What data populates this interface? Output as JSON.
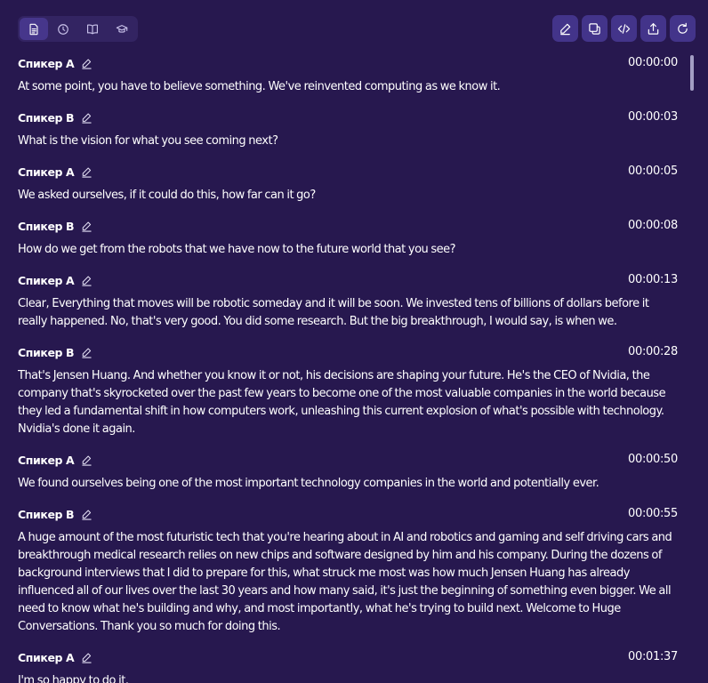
{
  "toolbar": {
    "tabs": [
      {
        "icon": "document-icon",
        "active": true
      },
      {
        "icon": "clock-icon",
        "active": false
      },
      {
        "icon": "book-icon",
        "active": false
      },
      {
        "icon": "graduation-cap-icon",
        "active": false
      }
    ],
    "actions": [
      {
        "icon": "pencil-icon"
      },
      {
        "icon": "copy-icon"
      },
      {
        "icon": "code-icon"
      },
      {
        "icon": "share-icon"
      },
      {
        "icon": "refresh-icon"
      }
    ]
  },
  "transcript": {
    "segments": [
      {
        "speaker": "Спикер A",
        "time": "00:00:00",
        "text": "At some point, you have to believe something. We've reinvented computing as we know it."
      },
      {
        "speaker": "Спикер B",
        "time": "00:00:03",
        "text": "What is the vision for what you see coming next?"
      },
      {
        "speaker": "Спикер A",
        "time": "00:00:05",
        "text": "We asked ourselves, if it could do this, how far can it go?"
      },
      {
        "speaker": "Спикер B",
        "time": "00:00:08",
        "text": "How do we get from the robots that we have now to the future world that you see?"
      },
      {
        "speaker": "Спикер A",
        "time": "00:00:13",
        "text": "Clear, Everything that moves will be robotic someday and it will be soon. We invested tens of billions of dollars before it really happened. No, that's very good. You did some research. But the big breakthrough, I would say, is when we."
      },
      {
        "speaker": "Спикер B",
        "time": "00:00:28",
        "text": "That's Jensen Huang. And whether you know it or not, his decisions are shaping your future. He's the CEO of Nvidia, the company that's skyrocketed over the past few years to become one of the most valuable companies in the world because they led a fundamental shift in how computers work, unleashing this current explosion of what's possible with technology. Nvidia's done it again."
      },
      {
        "speaker": "Спикер A",
        "time": "00:00:50",
        "text": "We found ourselves being one of the most important technology companies in the world and potentially ever."
      },
      {
        "speaker": "Спикер B",
        "time": "00:00:55",
        "text": "A huge amount of the most futuristic tech that you're hearing about in AI and robotics and gaming and self driving cars and breakthrough medical research relies on new chips and software designed by him and his company. During the dozens of background interviews that I did to prepare for this, what struck me most was how much Jensen Huang has already influenced all of our lives over the last 30 years and how many said, it's just the beginning of something even bigger. We all need to know what he's building and why, and most importantly, what he's trying to build next. Welcome to Huge Conversations. Thank you so much for doing this."
      },
      {
        "speaker": "Спикер A",
        "time": "00:01:37",
        "text": "I'm so happy to do it."
      }
    ]
  }
}
